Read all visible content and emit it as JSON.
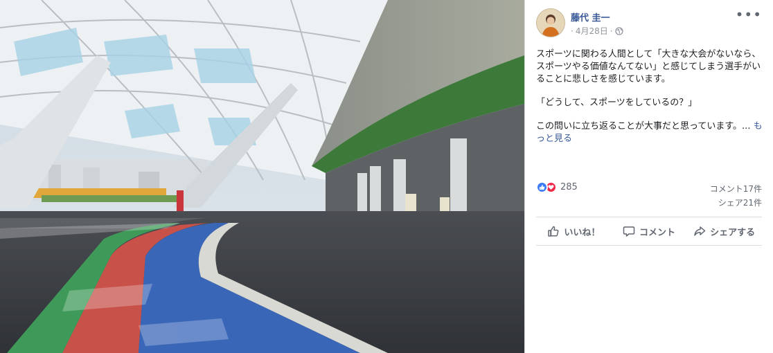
{
  "post": {
    "author": "藤代 圭一",
    "date": "4月28日",
    "separator": "·",
    "more_label": "•••",
    "paragraphs": [
      "スポーツに関わる人間として「大きな大会がないなら、スポーツやる価値なんてない」と感じてしまう選手がいることに悲しさを感じています。",
      "「どうして、スポーツをしているの？」",
      "この問いに立ち返ることが大事だと思っています。..."
    ],
    "see_more": "もっと見る"
  },
  "stats": {
    "reaction_count": "285",
    "comments": "コメント17件",
    "shares": "シェア21件"
  },
  "actions": {
    "like": "いいね！",
    "comment": "コメント",
    "share": "シェアする"
  },
  "icons": [
    "globe-icon",
    "like-icon",
    "love-icon",
    "comment-icon",
    "share-icon",
    "more-options-icon"
  ],
  "colors": {
    "link": "#385898",
    "meta": "#90949c",
    "like_blue": "#3b7bf7",
    "love_red": "#f0284a",
    "track_green": "#3f9a5a",
    "track_red": "#c8524a",
    "track_blue": "#3a66b8"
  }
}
